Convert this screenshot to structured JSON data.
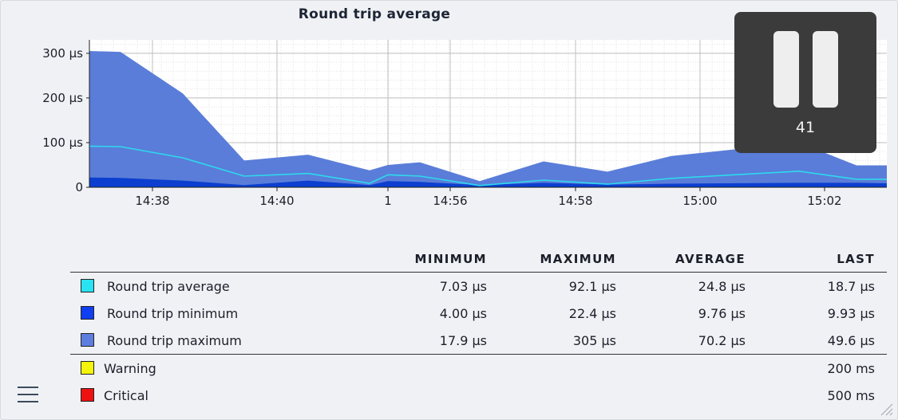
{
  "chart_data": {
    "type": "area",
    "title": "Round trip average",
    "yticks": [
      "300 µs",
      "200 µs",
      "100 µs",
      "0"
    ],
    "xticks": [
      "14:38",
      "14:40",
      "1",
      "14:56",
      "14:58",
      "15:00",
      "15:02"
    ],
    "series": [
      {
        "name": "Round trip maximum",
        "color": "#5a7dd9",
        "points": [
          [
            0,
            305
          ],
          [
            1,
            303
          ],
          [
            2,
            210
          ],
          [
            3,
            60
          ],
          [
            4,
            73
          ],
          [
            5,
            38
          ],
          [
            6,
            50
          ],
          [
            7,
            56
          ],
          [
            8,
            14
          ],
          [
            9,
            58
          ],
          [
            10,
            35
          ],
          [
            11,
            70
          ],
          [
            12,
            100
          ],
          [
            13,
            49
          ],
          [
            14,
            49
          ]
        ]
      },
      {
        "name": "Round trip minimum",
        "color": "#0c3fcf",
        "points": [
          [
            0,
            22
          ],
          [
            1,
            21
          ],
          [
            2,
            15
          ],
          [
            3,
            5
          ],
          [
            4,
            15
          ],
          [
            5,
            5
          ],
          [
            6,
            14
          ],
          [
            7,
            12
          ],
          [
            8,
            5
          ],
          [
            9,
            10
          ],
          [
            10,
            6
          ],
          [
            11,
            8
          ],
          [
            12,
            10
          ],
          [
            13,
            10
          ],
          [
            14,
            9
          ]
        ]
      },
      {
        "name": "Round trip average",
        "color": "#2ed9ec",
        "points": [
          [
            0,
            92
          ],
          [
            1,
            91
          ],
          [
            2,
            66
          ],
          [
            3,
            25
          ],
          [
            4,
            31
          ],
          [
            5,
            9
          ],
          [
            6,
            28
          ],
          [
            7,
            25
          ],
          [
            8,
            4
          ],
          [
            9,
            16
          ],
          [
            10,
            7
          ],
          [
            11,
            20
          ],
          [
            12,
            36
          ],
          [
            13,
            18
          ],
          [
            14,
            18
          ]
        ]
      }
    ],
    "ylim": [
      0,
      330
    ]
  },
  "overlay": {
    "count": "41"
  },
  "legend": {
    "headers": [
      "MINIMUM",
      "MAXIMUM",
      "AVERAGE",
      "LAST"
    ],
    "rows": [
      {
        "name": "Round trip average",
        "color": "#29e2f2",
        "min": "7.03 µs",
        "max": "92.1 µs",
        "avg": "24.8 µs",
        "last": "18.7 µs"
      },
      {
        "name": "Round trip minimum",
        "color": "#0f3ff0",
        "min": "4.00 µs",
        "max": "22.4 µs",
        "avg": "9.76 µs",
        "last": "9.93 µs"
      },
      {
        "name": "Round trip maximum",
        "color": "#5d7ee0",
        "min": "17.9 µs",
        "max": "305 µs",
        "avg": "70.2 µs",
        "last": "49.6 µs"
      }
    ],
    "thresholds": [
      {
        "name": "Warning",
        "color": "#f5f50a",
        "value": "200 ms"
      },
      {
        "name": "Critical",
        "color": "#ee1111",
        "value": "500 ms"
      }
    ]
  }
}
